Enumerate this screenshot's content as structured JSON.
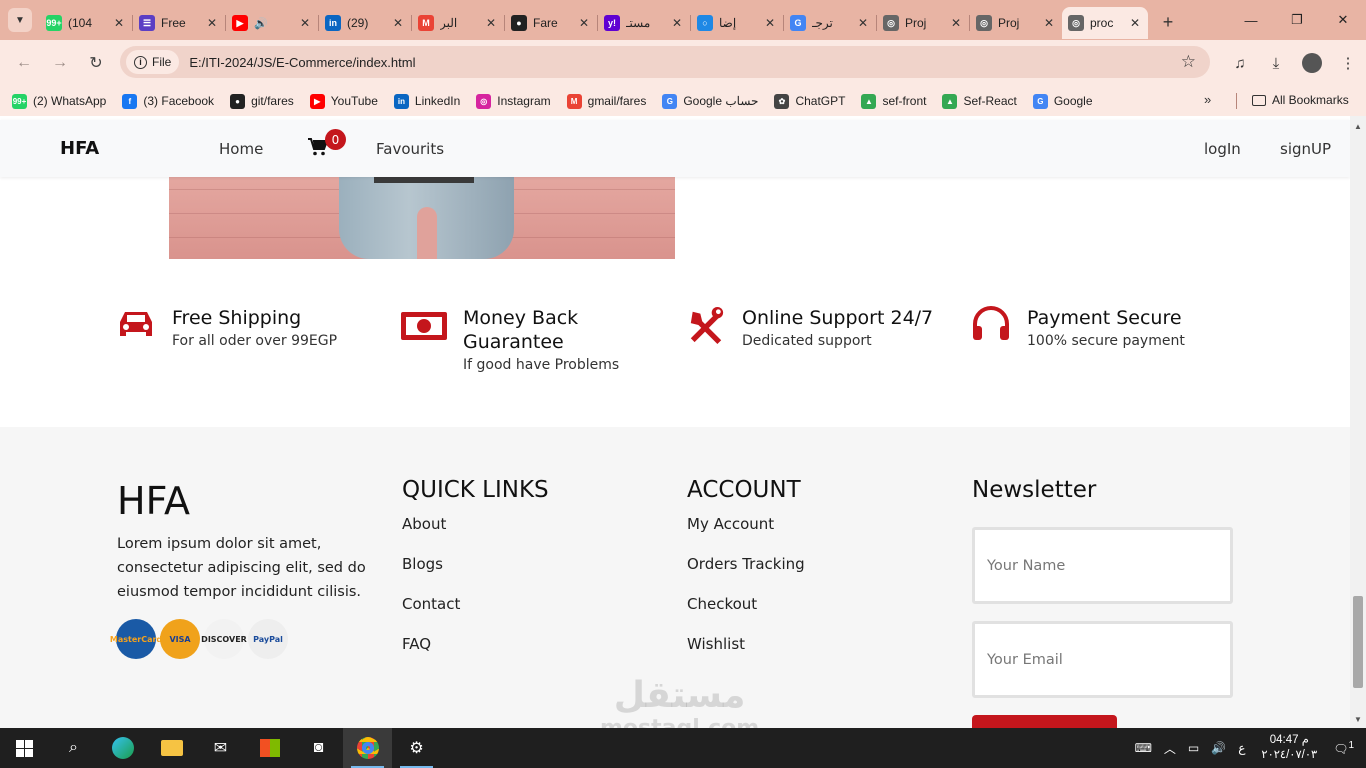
{
  "browser": {
    "tabs": [
      {
        "title": "(104",
        "favicon_color": "#25d366",
        "favicon_glyph": "99+",
        "icon": "whatsapp-icon"
      },
      {
        "title": "Free",
        "favicon_color": "#5b3fc4",
        "favicon_glyph": "☰",
        "icon": "form-icon"
      },
      {
        "title": "",
        "favicon_color": "#ff0000",
        "favicon_glyph": "▶",
        "icon": "youtube-icon",
        "audio": "🔊"
      },
      {
        "title": "(29)",
        "favicon_color": "#0a66c2",
        "favicon_glyph": "in",
        "icon": "linkedin-icon"
      },
      {
        "title": "البر",
        "favicon_color": "#ea4335",
        "favicon_glyph": "M",
        "icon": "gmail-icon"
      },
      {
        "title": "Fare",
        "favicon_color": "#222222",
        "favicon_glyph": "●",
        "icon": "github-icon"
      },
      {
        "title": "مستـ",
        "favicon_color": "#6001d2",
        "favicon_glyph": "y!",
        "icon": "yahoo-icon"
      },
      {
        "title": "إضا",
        "favicon_color": "#1e88e5",
        "favicon_glyph": "○",
        "icon": "circle-icon"
      },
      {
        "title": "ترجـ",
        "favicon_color": "#4285f4",
        "favicon_glyph": "G",
        "icon": "translate-icon"
      },
      {
        "title": "Proj",
        "favicon_color": "#666666",
        "favicon_glyph": "◎",
        "icon": "globe-icon"
      },
      {
        "title": "Proj",
        "favicon_color": "#666666",
        "favicon_glyph": "◎",
        "icon": "globe-icon"
      },
      {
        "title": "proc",
        "favicon_color": "#666666",
        "favicon_glyph": "◎",
        "icon": "globe-icon",
        "active": true
      }
    ],
    "address": {
      "scheme_label": "File",
      "url": "E:/ITI-2024/JS/E-Commerce/index.html"
    },
    "bookmarks": [
      {
        "label": "(2) WhatsApp",
        "color": "#25d366",
        "glyph": "99+"
      },
      {
        "label": "(3) Facebook",
        "color": "#1877f2",
        "glyph": "f"
      },
      {
        "label": "git/fares",
        "color": "#222222",
        "glyph": "●"
      },
      {
        "label": "YouTube",
        "color": "#ff0000",
        "glyph": "▶"
      },
      {
        "label": "LinkedIn",
        "color": "#0a66c2",
        "glyph": "in"
      },
      {
        "label": "Instagram",
        "color": "#d6249f",
        "glyph": "◎"
      },
      {
        "label": "gmail/fares",
        "color": "#ea4335",
        "glyph": "M"
      },
      {
        "label": "Google حساب",
        "color": "#4285f4",
        "glyph": "G"
      },
      {
        "label": "ChatGPT",
        "color": "#444444",
        "glyph": "✿"
      },
      {
        "label": "sef-front",
        "color": "#34a853",
        "glyph": "▲"
      },
      {
        "label": "Sef-React",
        "color": "#34a853",
        "glyph": "▲"
      },
      {
        "label": "Google",
        "color": "#4285f4",
        "glyph": "G"
      }
    ],
    "bookmarks_overflow": "»",
    "all_bookmarks": "All Bookmarks"
  },
  "site": {
    "brand": "HFA",
    "nav": {
      "home": "Home",
      "cart_count": "0",
      "favourites": "Favourits",
      "login": "logIn",
      "signup": "signUP"
    },
    "features": [
      {
        "title": "Free Shipping",
        "subtitle": "For all oder over 99EGP",
        "icon": "car-icon"
      },
      {
        "title": "Money Back Guarantee",
        "subtitle": "If good have Problems",
        "icon": "money-icon"
      },
      {
        "title": "Online Support 24/7",
        "subtitle": "Dedicated support",
        "icon": "tools-icon"
      },
      {
        "title": "Payment Secure",
        "subtitle": "100% secure payment",
        "icon": "headset-icon"
      }
    ],
    "accent_color": "#c4161c",
    "footer": {
      "brand": "HFA",
      "about": "Lorem ipsum dolor sit amet, consectetur adipiscing elit, sed do eiusmod tempor incididunt cilisis.",
      "cards": [
        {
          "name": "MasterCard",
          "bg": "#1a5aa6",
          "color": "#f7a21b"
        },
        {
          "name": "VISA",
          "bg": "#f0a21b",
          "color": "#1a3f93"
        },
        {
          "name": "DISCOVER",
          "bg": "#f2f2f2",
          "color": "#222222"
        },
        {
          "name": "PayPal",
          "bg": "#eeeeee",
          "color": "#1a4b9b"
        }
      ],
      "quick_links": {
        "title": "QUICK LINKS",
        "items": [
          "About",
          "Blogs",
          "Contact",
          "FAQ"
        ]
      },
      "account": {
        "title": "ACCOUNT",
        "items": [
          "My Account",
          "Orders Tracking",
          "Checkout",
          "Wishlist"
        ]
      },
      "newsletter": {
        "title": "Newsletter",
        "name_placeholder": "Your Name",
        "email_placeholder": "Your Email"
      }
    }
  },
  "watermark": {
    "arabic": "مستقل",
    "latin": "mostaql.com"
  },
  "taskbar": {
    "clock_time": "04:47 م",
    "clock_date": "٢٠٢٤/٠٧/٠٣",
    "lang": "ع",
    "notifications": "1"
  }
}
